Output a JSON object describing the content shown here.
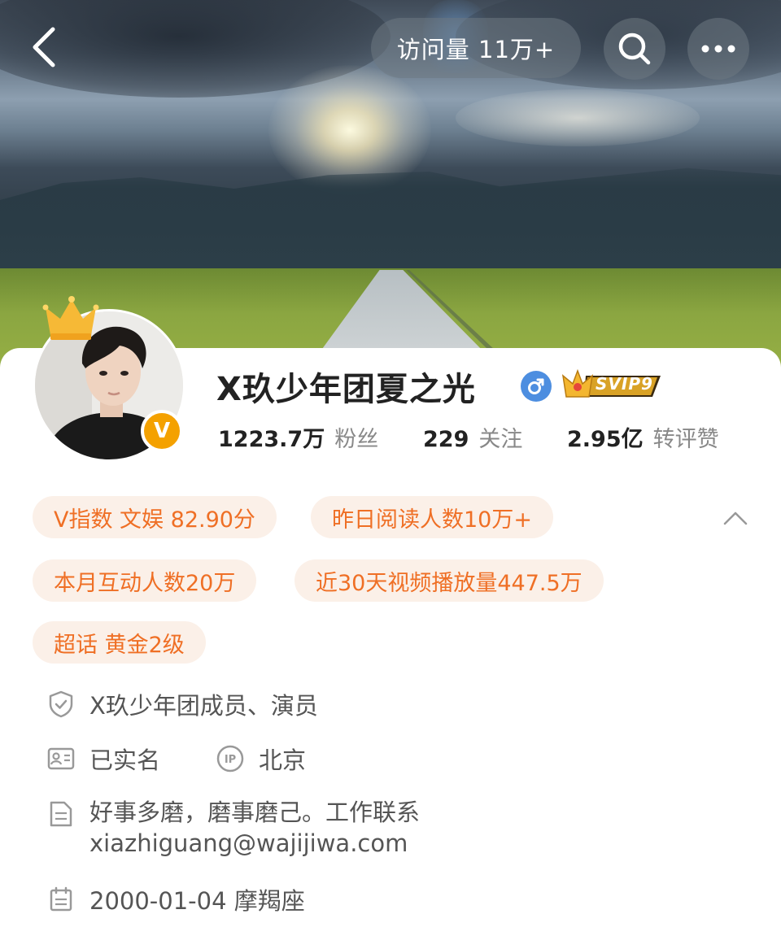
{
  "header": {
    "visits_label": "访问量 11万+"
  },
  "profile": {
    "name": "X玖少年团夏之光",
    "gender": "male",
    "svip_label": "SVIP9",
    "verified_badge": "V",
    "stats": [
      {
        "value": "1223.7万",
        "label": "粉丝"
      },
      {
        "value": "229",
        "label": "关注"
      },
      {
        "value": "2.95亿",
        "label": "转评赞"
      }
    ]
  },
  "tags": {
    "vindex": "V指数 文娱 82.90分",
    "read": "昨日阅读人数10万+",
    "interact": "本月互动人数20万",
    "video": "近30天视频播放量447.5万",
    "supertopic": "超话 黄金2级"
  },
  "info": {
    "identity": "X玖少年团成员、演员",
    "realname": "已实名",
    "ip": "北京",
    "bio_line1": "好事多磨，磨事磨己。工作联系",
    "bio_line2": "xiazhiguang@wajijiwa.com",
    "birthday": "2000-01-04 摩羯座"
  },
  "colors": {
    "accent_orange": "#ef6f25",
    "tag_bg": "#fbf0e8",
    "gender_blue": "#4d8ee0",
    "v_badge": "#f4a100"
  },
  "icons": [
    "back-arrow-icon",
    "search-icon",
    "more-icon",
    "crown-icon",
    "verified-v-icon",
    "male-icon",
    "svip-crown-icon",
    "chevron-up-icon",
    "shield-icon",
    "id-card-icon",
    "ip-icon",
    "document-icon",
    "calendar-icon"
  ]
}
